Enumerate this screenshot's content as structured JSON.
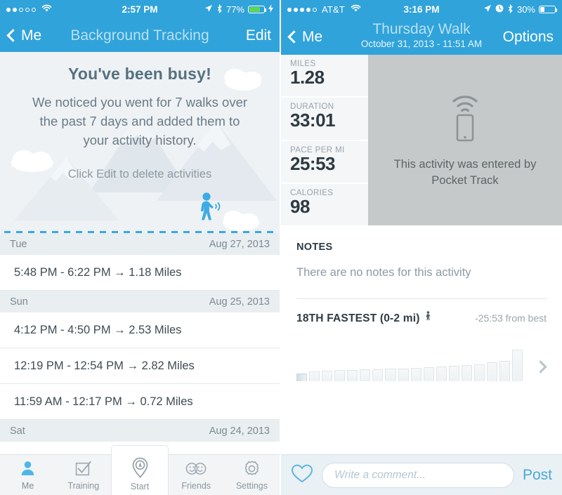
{
  "left": {
    "statusbar": {
      "signal_dots": 5,
      "signal_filled": 2,
      "wifi": "wifi-icon",
      "time": "2:57 PM",
      "location": "location-arrow-icon",
      "bluetooth": "bluetooth-icon",
      "battery_text": "77%",
      "battery_level": 77,
      "charging": true
    },
    "navbar": {
      "back_label": "Me",
      "title": "Background Tracking",
      "action_label": "Edit"
    },
    "banner": {
      "heading": "You've been busy!",
      "body": "We noticed you went for 7 walks over the past 7 days and added them to your activity history.",
      "hint": "Click Edit to delete activities",
      "icon": "walking-person-signal-icon"
    },
    "sections": [
      {
        "day": "Tue",
        "date": "Aug 27, 2013",
        "rows": [
          "5:48 PM - 6:22 PM  →  1.18 Miles"
        ]
      },
      {
        "day": "Sun",
        "date": "Aug 25, 2013",
        "rows": [
          "4:12 PM - 4:50 PM  →  2.53 Miles",
          "12:19 PM - 12:54 PM  →  2.82 Miles",
          "11:59 AM - 12:17 PM  →  0.72 Miles"
        ]
      },
      {
        "day": "Sat",
        "date": "Aug 24, 2013",
        "rows": []
      }
    ],
    "tabs": [
      {
        "label": "Me",
        "icon": "person-icon",
        "active": true
      },
      {
        "label": "Training",
        "icon": "checkbox-check-icon",
        "active": false
      },
      {
        "label": "Start",
        "icon": "location-pin-compass-icon",
        "active": false,
        "raised": true
      },
      {
        "label": "Friends",
        "icon": "two-smiley-faces-icon",
        "active": false
      },
      {
        "label": "Settings",
        "icon": "gear-icon",
        "active": false
      }
    ]
  },
  "right": {
    "statusbar": {
      "signal_dots": 5,
      "signal_filled": 4,
      "carrier": "AT&T",
      "wifi": "wifi-icon",
      "time": "3:16 PM",
      "location": "location-arrow-icon",
      "alarm": "alarm-clock-icon",
      "bluetooth": "bluetooth-icon",
      "battery_text": "30%",
      "battery_level": 30,
      "charging": false
    },
    "navbar": {
      "back_label": "Me",
      "title": "Thursday Walk",
      "subtitle": "October 31, 2013 - 11:51 AM",
      "action_label": "Options"
    },
    "stats": [
      {
        "key": "MILES",
        "value": "1.28"
      },
      {
        "key": "DURATION",
        "value": "33:01"
      },
      {
        "key": "PACE PER MI",
        "value": "25:53"
      },
      {
        "key": "CALORIES",
        "value": "98"
      }
    ],
    "source": {
      "icon": "phone-wifi-icon",
      "line1": "This activity was entered by",
      "line2": "Pocket Track"
    },
    "notes": {
      "title": "NOTES",
      "empty": "There are no notes for this activity"
    },
    "performance": {
      "title": "18TH FASTEST (0-2 mi)",
      "icon": "walking-person-icon",
      "from_best": "-25:53 from best",
      "next": "chevron-right-icon"
    },
    "comment": {
      "like_icon": "heart-outline-icon",
      "placeholder": "Write a comment...",
      "value": "",
      "post_label": "Post"
    }
  },
  "chart_data": {
    "type": "bar",
    "title": "18TH FASTEST (0-2 mi)",
    "annotation": "-25:53 from best",
    "categories": [
      "1",
      "2",
      "3",
      "4",
      "5",
      "6",
      "7",
      "8",
      "9",
      "10",
      "11",
      "12",
      "13",
      "14",
      "15",
      "16",
      "17",
      "18"
    ],
    "values": [
      16,
      20,
      22,
      23,
      24,
      25,
      25,
      26,
      27,
      28,
      30,
      31,
      32,
      34,
      36,
      40,
      43,
      66
    ],
    "highlighted_index": 0,
    "xlabel": "",
    "ylabel": "",
    "ylim": [
      0,
      70
    ],
    "grid": false,
    "legend": false
  },
  "colors": {
    "header_blue": "#30a3da",
    "accent_blue": "#4ba8d8",
    "banner_bg": "#eef2f5",
    "section_bg": "#e9eef1",
    "source_gray": "#c6c9ca",
    "battery_green": "#5ed94f"
  }
}
